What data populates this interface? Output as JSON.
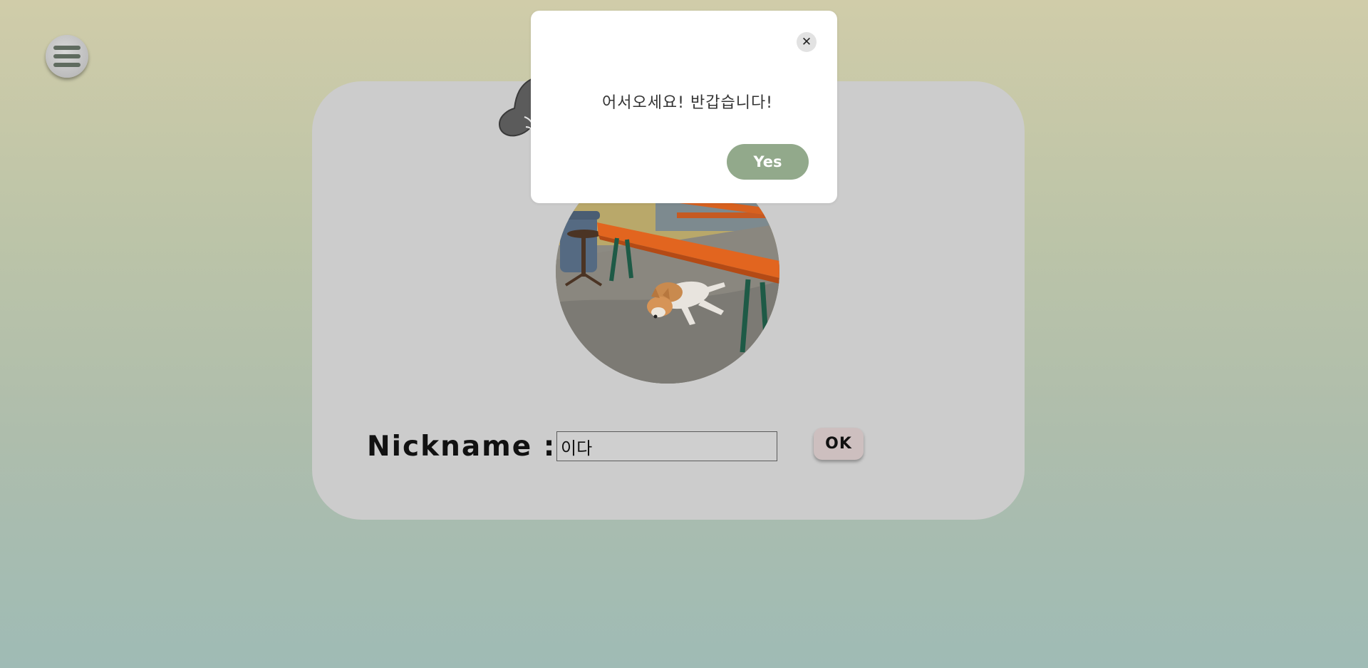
{
  "menu": {
    "icon": "hamburger-menu-icon"
  },
  "profile": {
    "nickname_label": "Nickname :",
    "nickname_value": "이다",
    "ok_label": "OK",
    "photo_icon": "profile-photo-dog"
  },
  "dialog": {
    "message": "어서오세요! 반갑습니다!",
    "close_glyph": "✕",
    "yes_label": "Yes"
  },
  "colors": {
    "card_bg": "#cccccc",
    "yes_button": "#92a98b",
    "ok_button": "#cdbfbf"
  }
}
